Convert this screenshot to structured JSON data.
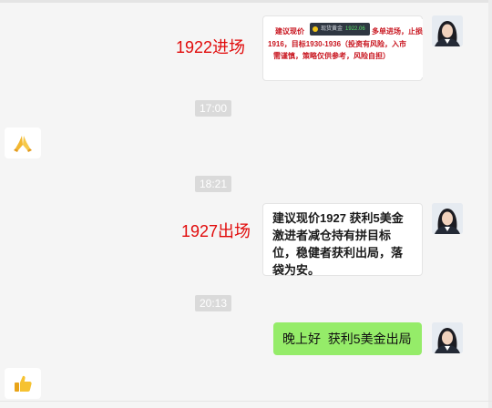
{
  "messages": {
    "m1": {
      "image_text": {
        "line1_left": "建议现价",
        "line1_right": "多单进场，止损",
        "line2": "1916，目标1930-1936（投资有风险，入市",
        "line3": "需谨慎，策略仅供参考，风险自担）",
        "chip_label": "现货黄金",
        "chip_price": "1922.06"
      },
      "overlay": "1922进场"
    },
    "t1": "17:00",
    "m2": {
      "emoji": "pray-emoji"
    },
    "t2": "18:21",
    "m3": {
      "text": "建议现价1927 获利5美金激进者减仓持有拼目标位，稳健者获利出局，落袋为安。",
      "overlay": "1927出场"
    },
    "t3": "20:13",
    "m4": {
      "text": "晚上好  获利5美金出局"
    },
    "m5": {
      "emoji": "thumbs-up-emoji"
    }
  },
  "colors": {
    "chat_bg": "#f5f5f5",
    "green_bubble": "#95ec69",
    "overlay_red": "#e10b0b",
    "time_badge": "#dadada"
  }
}
